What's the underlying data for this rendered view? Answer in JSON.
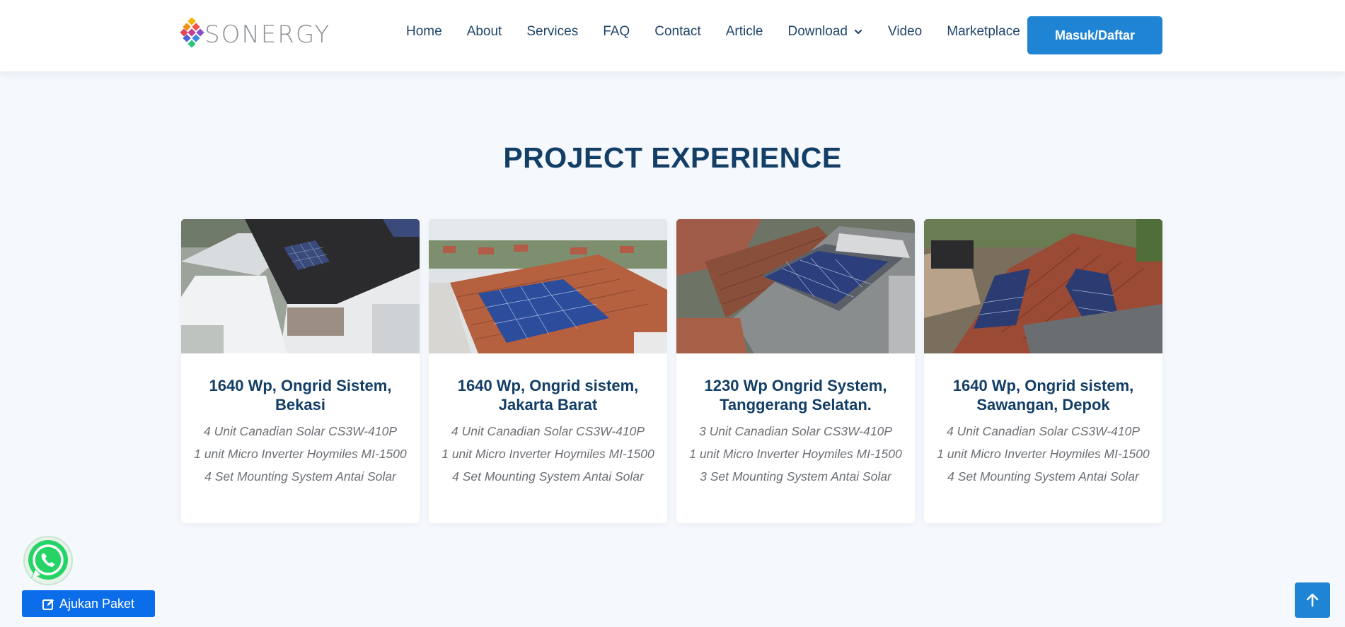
{
  "header": {
    "brand": "SONERGY",
    "nav": [
      {
        "label": "Home"
      },
      {
        "label": "About"
      },
      {
        "label": "Services"
      },
      {
        "label": "FAQ"
      },
      {
        "label": "Contact"
      },
      {
        "label": "Article"
      },
      {
        "label": "Download",
        "icon": "chevron-down-icon"
      },
      {
        "label": "Video"
      },
      {
        "label": "Marketplace"
      }
    ],
    "login_label": "Masuk/Daftar"
  },
  "section": {
    "title": "PROJECT EXPERIENCE"
  },
  "projects": [
    {
      "title": "1640 Wp, Ongrid Sistem, Bekasi",
      "lines": [
        "4 Unit Canadian Solar CS3W-410P",
        "1 unit Micro Inverter Hoymiles MI-1500",
        "4 Set Mounting System Antai Solar"
      ]
    },
    {
      "title": "1640 Wp, Ongrid sistem, Jakarta Barat",
      "lines": [
        "4 Unit Canadian Solar CS3W-410P",
        "1 unit Micro Inverter Hoymiles MI-1500",
        "4 Set Mounting System Antai Solar"
      ]
    },
    {
      "title": "1230 Wp Ongrid System, Tanggerang Selatan.",
      "lines": [
        "3 Unit Canadian Solar CS3W-410P",
        "1 unit Micro Inverter Hoymiles MI-1500",
        "3 Set Mounting System Antai Solar"
      ]
    },
    {
      "title": "1640 Wp, Ongrid sistem, Sawangan, Depok",
      "lines": [
        "4 Unit Canadian Solar CS3W-410P",
        "1 unit Micro Inverter Hoymiles MI-1500",
        "4 Set Mounting System Antai Solar"
      ]
    }
  ],
  "floating": {
    "whatsapp_icon": "whatsapp-icon",
    "apply_label": "Ajukan Paket",
    "apply_icon": "edit-icon",
    "top_icon": "arrow-up-icon"
  },
  "colors": {
    "primary": "#1f84d4",
    "heading": "#133e66",
    "apply": "#0b6dea",
    "whatsapp": "#25d366"
  }
}
